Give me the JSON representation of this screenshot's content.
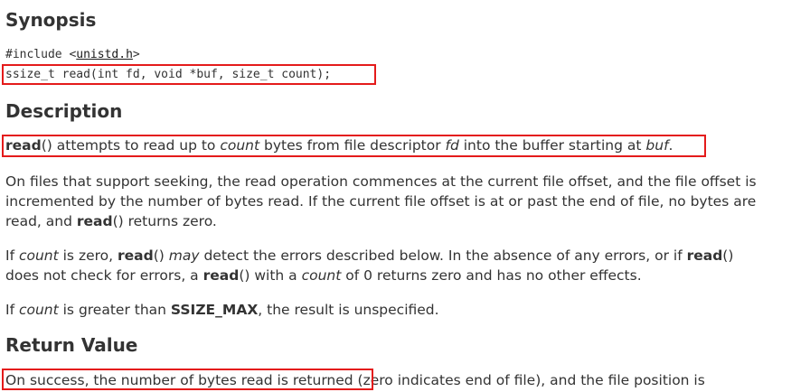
{
  "sections": {
    "synopsis_heading": "Synopsis",
    "description_heading": "Description",
    "return_heading": "Return Value"
  },
  "synopsis": {
    "include_prefix": "#include <",
    "include_header": "unistd.h",
    "include_suffix": ">",
    "prototype": "ssize_t read(int fd, void *buf, size_t count);"
  },
  "description": {
    "p1": {
      "t1": "read",
      "t2": "() attempts to read up to ",
      "t3": "count",
      "t4": " bytes from file descriptor ",
      "t5": "fd",
      "t6": " into the buffer starting at ",
      "t7": "buf",
      "t8": "."
    },
    "p2": {
      "l1": "On files that support seeking, the read operation commences at the current file offset, and the file offset is",
      "l2": "incremented by the number of bytes read. If the current file offset is at or past the end of file, no bytes are",
      "l3a": "read, and ",
      "l3b": "read",
      "l3c": "() returns zero."
    },
    "p3": {
      "a1": "If ",
      "a2": "count",
      "a3": " is zero, ",
      "a4": "read",
      "a5": "() ",
      "a6": "may",
      "a7": " detect the errors described below. In the absence of any errors, or if ",
      "a8": "read",
      "a9": "()",
      "b1": "does not check for errors, a ",
      "b2": "read",
      "b3": "() with a ",
      "b4": "count",
      "b5": " of 0 returns zero and has no other effects."
    },
    "p4": {
      "c1": "If ",
      "c2": "count",
      "c3": " is greater than ",
      "c4": "SSIZE_MAX",
      "c5": ", the result is unspecified."
    }
  },
  "return_value": {
    "highlighted": "On success, the number of bytes read is returned",
    "rest": " (zero indicates end of file), and the file position is"
  },
  "colors": {
    "highlight_border": "#e41b1b",
    "text": "#333333"
  }
}
